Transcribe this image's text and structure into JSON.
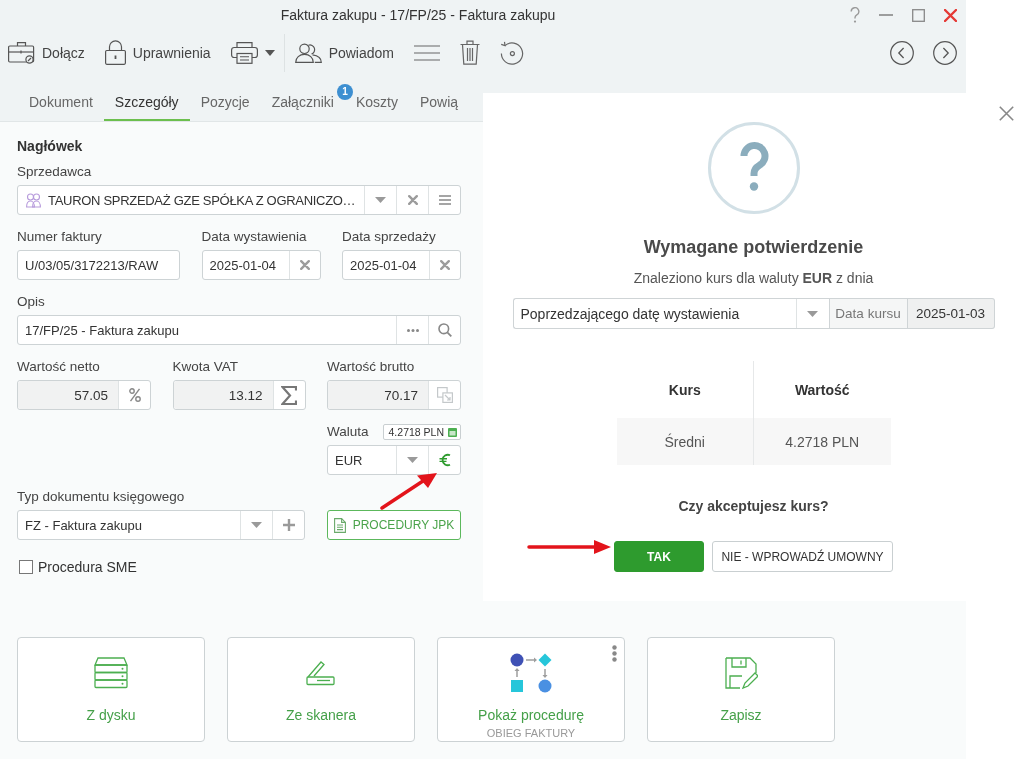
{
  "window": {
    "title": "Faktura zakupu - 17/FP/25 - Faktura zakupu",
    "controls": [
      {
        "kind": "help"
      },
      {
        "kind": "minimize"
      },
      {
        "kind": "maximize"
      },
      {
        "kind": "close"
      }
    ]
  },
  "toolbar": {
    "items": [
      {
        "kind": "attach",
        "label": "Dołącz"
      },
      {
        "kind": "permissions",
        "label": "Uprawnienia"
      },
      {
        "kind": "print"
      },
      {
        "kind": "notify",
        "label": "Powiadom"
      },
      {
        "kind": "menu"
      },
      {
        "kind": "delete"
      },
      {
        "kind": "restore"
      }
    ],
    "navigation": [
      {
        "kind": "previous"
      },
      {
        "kind": "next"
      }
    ]
  },
  "tabs": [
    {
      "label": "Dokument",
      "selected": false
    },
    {
      "label": "Szczegóły",
      "selected": true
    },
    {
      "label": "Pozycje",
      "selected": false
    },
    {
      "label": "Załączniki",
      "selected": false,
      "badge": "1"
    },
    {
      "label": "Koszty",
      "selected": false
    },
    {
      "label": "Powią",
      "selected": false
    }
  ],
  "form": {
    "heading": "Nagłówek",
    "seller": {
      "label": "Sprzedawca",
      "value": "TAURON SPRZEDAŻ GZE SPÓŁKA Z OGRANICZO…"
    },
    "invoice_number": {
      "label": "Numer faktury",
      "value": "U/03/05/3172213/RAW"
    },
    "issue_date": {
      "label": "Data wystawienia",
      "value": "2025-01-04"
    },
    "sale_date": {
      "label": "Data sprzedaży",
      "value": "2025-01-04"
    },
    "description": {
      "label": "Opis",
      "value": "17/FP/25 - Faktura zakupu"
    },
    "net_value": {
      "label": "Wartość netto",
      "value": "57.05"
    },
    "vat_amount": {
      "label": "Kwota VAT",
      "value": "13.12"
    },
    "gross_value": {
      "label": "Wartość brutto",
      "value": "70.17"
    },
    "currency": {
      "label": "Waluta",
      "rate_badge": "4.2718 PLN",
      "value": "EUR"
    },
    "document_type": {
      "label": "Typ dokumentu księgowego",
      "value": "FZ - Faktura zakupu"
    },
    "jpk_button": "PROCEDURY JPK",
    "sme_procedure": {
      "label": "Procedura SME",
      "checked": false
    }
  },
  "actions": [
    {
      "kind": "disk",
      "label": "Z dysku"
    },
    {
      "kind": "scanner",
      "label": "Ze skanera"
    },
    {
      "kind": "procedure",
      "label": "Pokaż procedurę",
      "sublabel": "OBIEG FAKTURY"
    },
    {
      "kind": "save",
      "label": "Zapisz"
    }
  ],
  "dialog": {
    "title": "Wymagane potwierdzenie",
    "message": "Znaleziono kurs dla waluty **EUR** z dnia",
    "rate_source": "Poprzedzającego datę wystawienia",
    "rate_date": {
      "label": "Data kursu",
      "value": "2025-01-03"
    },
    "table": {
      "columns": [
        "Kurs",
        "Wartość"
      ],
      "rows": [
        [
          "Średni",
          "4.2718 PLN"
        ]
      ]
    },
    "question": "Czy akceptujesz kurs?",
    "buttons": [
      {
        "kind": "primary",
        "label": "TAK"
      },
      {
        "kind": "secondary",
        "label": "NIE - WPROWADŹ UMOWNY"
      }
    ]
  }
}
